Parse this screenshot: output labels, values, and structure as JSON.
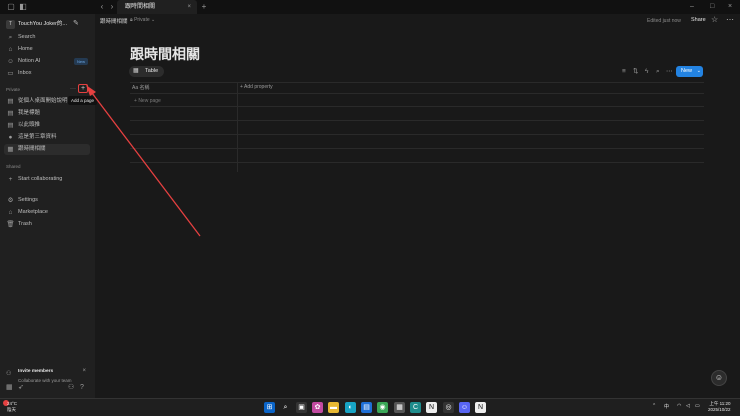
{
  "tabbar": {
    "tab_title": "跟時間相關",
    "tab_close": "×",
    "new_tab": "+",
    "back": "‹",
    "forward": "›",
    "minimize": "–",
    "maximize": "□",
    "close": "×"
  },
  "sidebar": {
    "workspace_avatar": "T",
    "workspace_name": "TouchYou Joker的...",
    "nav": [
      {
        "label": "Search",
        "icon": "search-icon"
      },
      {
        "label": "Home",
        "icon": "home-icon"
      },
      {
        "label": "Notion AI",
        "icon": "ai-icon",
        "badge": "New"
      },
      {
        "label": "Inbox",
        "icon": "inbox-icon"
      }
    ],
    "private_label": "Private",
    "private_more": "···",
    "add_page_plus": "+",
    "add_page_tooltip": "Add a page",
    "pages": [
      {
        "label": "從個人桌面開始說明"
      },
      {
        "label": "我是標題"
      },
      {
        "label": "以此頭推"
      },
      {
        "label": "這是第三章資料"
      },
      {
        "label": "跟時間相關",
        "active": true
      }
    ],
    "shared_label": "Shared",
    "start_collaborating": "Start collaborating",
    "bottom_nav": [
      {
        "label": "Settings"
      },
      {
        "label": "Marketplace"
      },
      {
        "label": "Trash"
      }
    ],
    "invite_title": "Invite members",
    "invite_sub": "Collaborate with your team",
    "invite_close": "×"
  },
  "header": {
    "breadcrumb": "跟時間相關",
    "privacy": "Private",
    "edited": "Edited just now",
    "share": "Share"
  },
  "page": {
    "title": "跟時間相關",
    "view_tab": "Table",
    "new_button": "New",
    "columns": [
      {
        "label": "名稱",
        "icon": "Aa"
      },
      {
        "label": "Add property",
        "icon": "+"
      }
    ],
    "new_page": "New page"
  },
  "taskbar": {
    "temperature": "24°C",
    "weather_desc": "陰天",
    "ime": "中",
    "time": "上午 11:20",
    "date": "2025/10/22"
  },
  "colors": {
    "accent": "#2383e2",
    "annotation": "#e54040"
  }
}
